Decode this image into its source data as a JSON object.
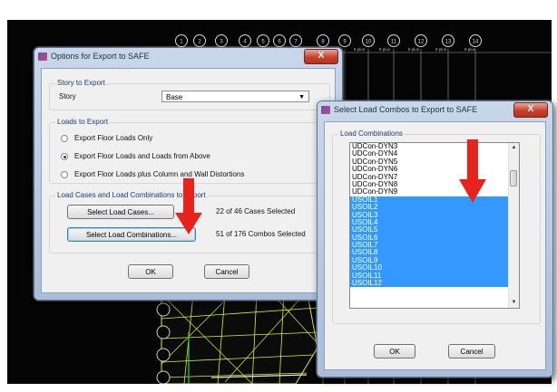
{
  "grid": {
    "bubbles": [
      "1",
      "2",
      "3",
      "4",
      "5",
      "6",
      "7",
      "8",
      "9",
      "10",
      "11",
      "12",
      "13",
      "14"
    ],
    "dims": [
      "8 plus",
      "8 plus",
      "8 plus",
      "8 plus",
      "6 plus"
    ]
  },
  "export_dialog": {
    "title": "Options for Export to SAFE",
    "close": "X",
    "story_group": "Story to Export",
    "story_label": "Story",
    "story_value": "Base",
    "loads_group": "Loads to Export",
    "radio_options": [
      {
        "label": "Export Floor Loads Only",
        "checked": false
      },
      {
        "label": "Export Floor Loads and Loads from Above",
        "checked": true
      },
      {
        "label": "Export Floor Loads plus Column and Wall Distortions",
        "checked": false
      }
    ],
    "cases_group": "Load Cases and Load Combinations to Export",
    "select_cases_button": "Select Load Cases...",
    "cases_status": "22 of 46 Cases Selected",
    "select_combos_button": "Select Load Combinations...",
    "combos_status": "51 of 176 Combos Selected",
    "ok": "OK",
    "cancel": "Cancel"
  },
  "combos_dialog": {
    "title": "Select Load Combos to Export to SAFE",
    "close": "X",
    "group": "Load Combinations",
    "items": [
      {
        "label": "UDCon-DYN3",
        "selected": false
      },
      {
        "label": "UDCon-DYN4",
        "selected": false
      },
      {
        "label": "UDCon-DYN5",
        "selected": false
      },
      {
        "label": "UDCon-DYN6",
        "selected": false
      },
      {
        "label": "UDCon-DYN7",
        "selected": false
      },
      {
        "label": "UDCon-DYN8",
        "selected": false
      },
      {
        "label": "UDCon-DYN9",
        "selected": false
      },
      {
        "label": "USOIL1",
        "selected": true
      },
      {
        "label": "USOIL2",
        "selected": true
      },
      {
        "label": "USOIL3",
        "selected": true
      },
      {
        "label": "USOIL4",
        "selected": true
      },
      {
        "label": "USOIL5",
        "selected": true
      },
      {
        "label": "USOIL6",
        "selected": true
      },
      {
        "label": "USOIL7",
        "selected": true
      },
      {
        "label": "USOIL8",
        "selected": true
      },
      {
        "label": "USOIL9",
        "selected": true
      },
      {
        "label": "USOIL10",
        "selected": true
      },
      {
        "label": "USOIL11",
        "selected": true
      },
      {
        "label": "USOIL12",
        "selected": true
      }
    ],
    "ok": "OK",
    "cancel": "Cancel"
  },
  "colors": {
    "selection": "#3399ff",
    "annotation_arrow": "#e8231c",
    "slab_lines": "#d9f02a",
    "grid_lines": "#9aa0a8"
  },
  "icons": {
    "close": "close-icon",
    "app": "app-icon",
    "dropdown": "chevron-down-icon",
    "scroll_up": "scroll-up-icon",
    "scroll_down": "scroll-down-icon",
    "annotation": "red-arrow-icon"
  }
}
